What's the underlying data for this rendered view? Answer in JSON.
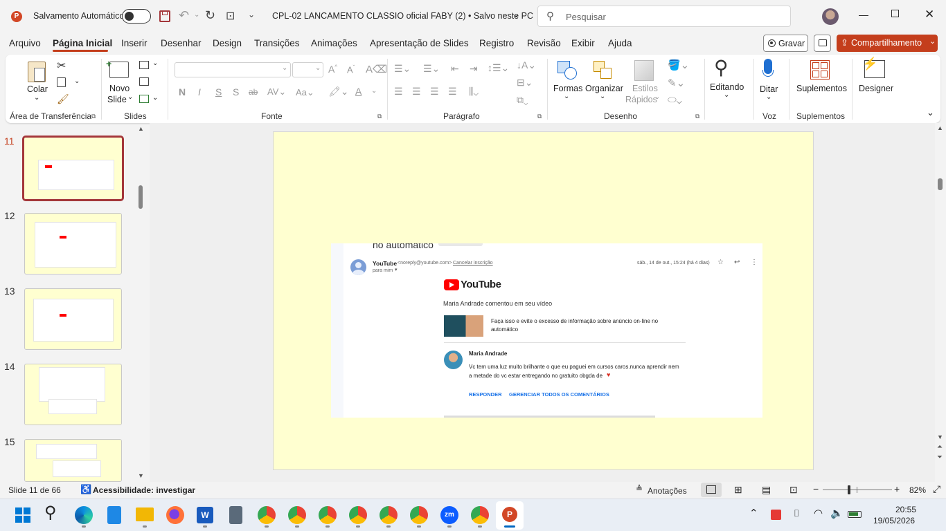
{
  "titlebar": {
    "autosave_label": "Salvamento Automático",
    "doc_title": "CPL-02 LANCAMENTO CLASSIO oficial FABY (2) • Salvo neste PC",
    "search_placeholder": "Pesquisar",
    "autosave_state": "off"
  },
  "menu": {
    "tabs": [
      "Arquivo",
      "Página Inicial",
      "Inserir",
      "Desenhar",
      "Design",
      "Transições",
      "Animações",
      "Apresentação de Slides",
      "Registro",
      "Revisão",
      "Exibir",
      "Ajuda"
    ],
    "active_tab": "Página Inicial",
    "record_label": "Gravar",
    "share_label": "Compartilhamento"
  },
  "ribbon": {
    "clipboard": {
      "paste_label": "Colar",
      "group_label": "Área de Transferência"
    },
    "slides": {
      "new_slide_line1": "Novo",
      "new_slide_line2": "Slide",
      "group_label": "Slides"
    },
    "font": {
      "group_label": "Fonte",
      "font_name": "",
      "font_size": ""
    },
    "paragraph": {
      "group_label": "Parágrafo"
    },
    "drawing": {
      "shapes_label": "Formas",
      "arrange_label": "Organizar",
      "quick_styles_line1": "Estilos",
      "quick_styles_line2": "Rápidos",
      "group_label": "Desenho"
    },
    "editing": {
      "label": "Editando"
    },
    "voice": {
      "dictate_label": "Ditar",
      "group_label": "Voz"
    },
    "addins": {
      "label": "Suplementos",
      "group_label": "Suplementos"
    },
    "designer": {
      "label": "Designer"
    }
  },
  "slides_panel": {
    "thumbnails": [
      {
        "number": "11",
        "selected": true
      },
      {
        "number": "12",
        "selected": false
      },
      {
        "number": "13",
        "selected": false
      },
      {
        "number": "14",
        "selected": false
      },
      {
        "number": "15",
        "selected": false
      }
    ]
  },
  "slide": {
    "email": {
      "top_fragment": "no automático",
      "sender": "YouTube",
      "sender_addr": "<noreply@youtube.com>",
      "unsubscribe": "Cancelar inscrição",
      "to_line": "para mim",
      "date": "sáb., 14 de out., 15:24 (há 4 dias)",
      "logo_text": "YouTube",
      "headline": "Maria Andrade comentou em seu vídeo",
      "video_title_line1": "Faça isso e evite o excesso de informação sobre anúncio on-line no",
      "video_title_line2": "automático",
      "commenter": "Maria Andrade",
      "comment_line1": "Vc tem uma luz muito brilhante o que eu paguei em cursos caros.nunca aprendir nem",
      "comment_line2": "a metade do vc estar entregando no gratuito obgda de",
      "reply_label": "RESPONDER",
      "manage_label": "GERENCIAR TODOS OS COMENTÁRIOS"
    }
  },
  "statusbar": {
    "slide_info": "Slide 11 de 66",
    "accessibility": "Acessibilidade: investigar",
    "notes_label": "Anotações",
    "zoom": "82%",
    "zoom_fraction": 0.5
  },
  "taskbar": {
    "time": "20:55",
    "date": "19/05/2026"
  },
  "colors": {
    "accent_red": "#c43e1c",
    "slide_bg": "#ffffd0",
    "link_blue": "#1a73e8",
    "youtube_red": "#ff0000"
  }
}
